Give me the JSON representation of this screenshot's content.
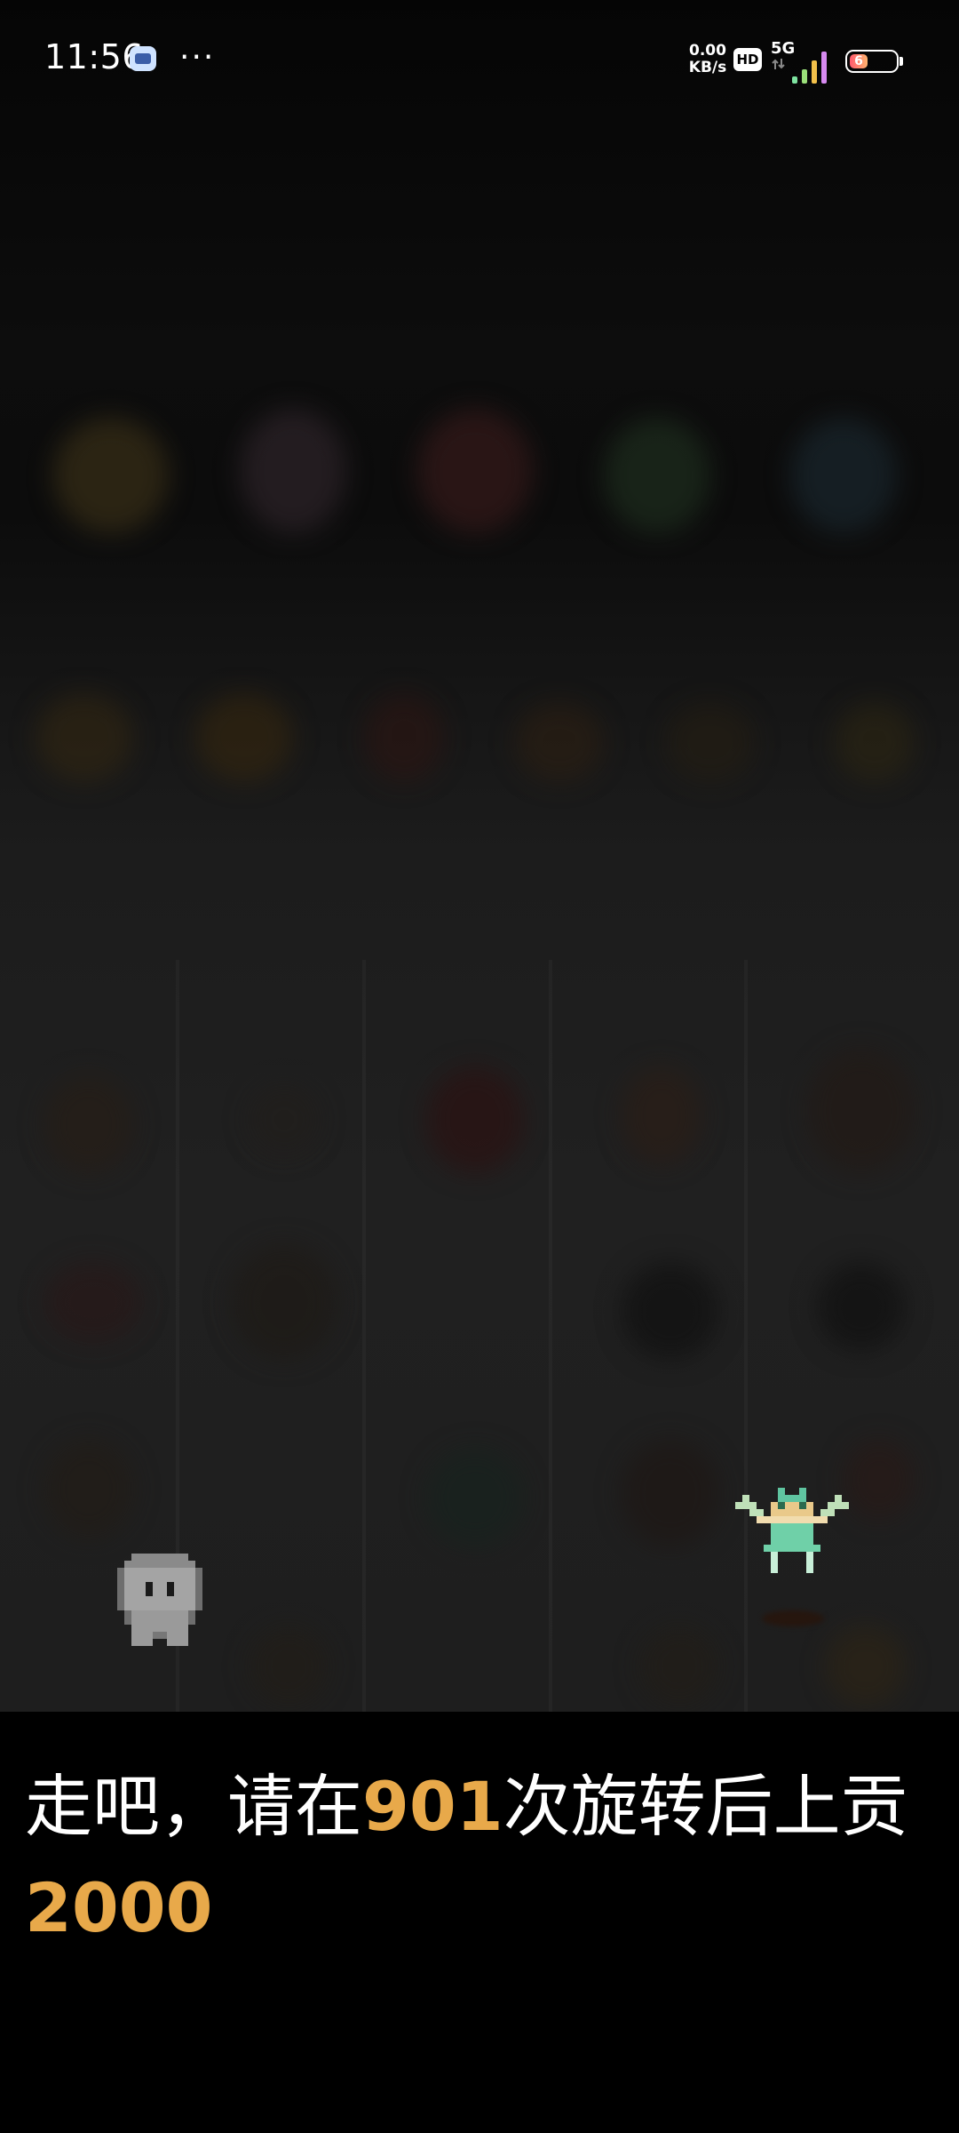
{
  "status_bar": {
    "time": "11:56",
    "more": "···",
    "net_speed_value": "0.00",
    "net_speed_unit": "KB/s",
    "hd_badge": "HD",
    "network_type": "5G",
    "battery_level": "6",
    "app_icon": "notification-app-icon",
    "signal_icon": "signal-strength-icon"
  },
  "dialog": {
    "text_before": "走吧，请在",
    "rotations": "901",
    "text_middle": "次旋转后上贡",
    "tribute": "2000"
  },
  "colors": {
    "highlight": "#e8a94a",
    "text": "#ffffff",
    "dialog_bg": "#000000"
  },
  "sprites": {
    "player": "ghost-player-sprite",
    "monster": "winged-creature-sprite"
  }
}
